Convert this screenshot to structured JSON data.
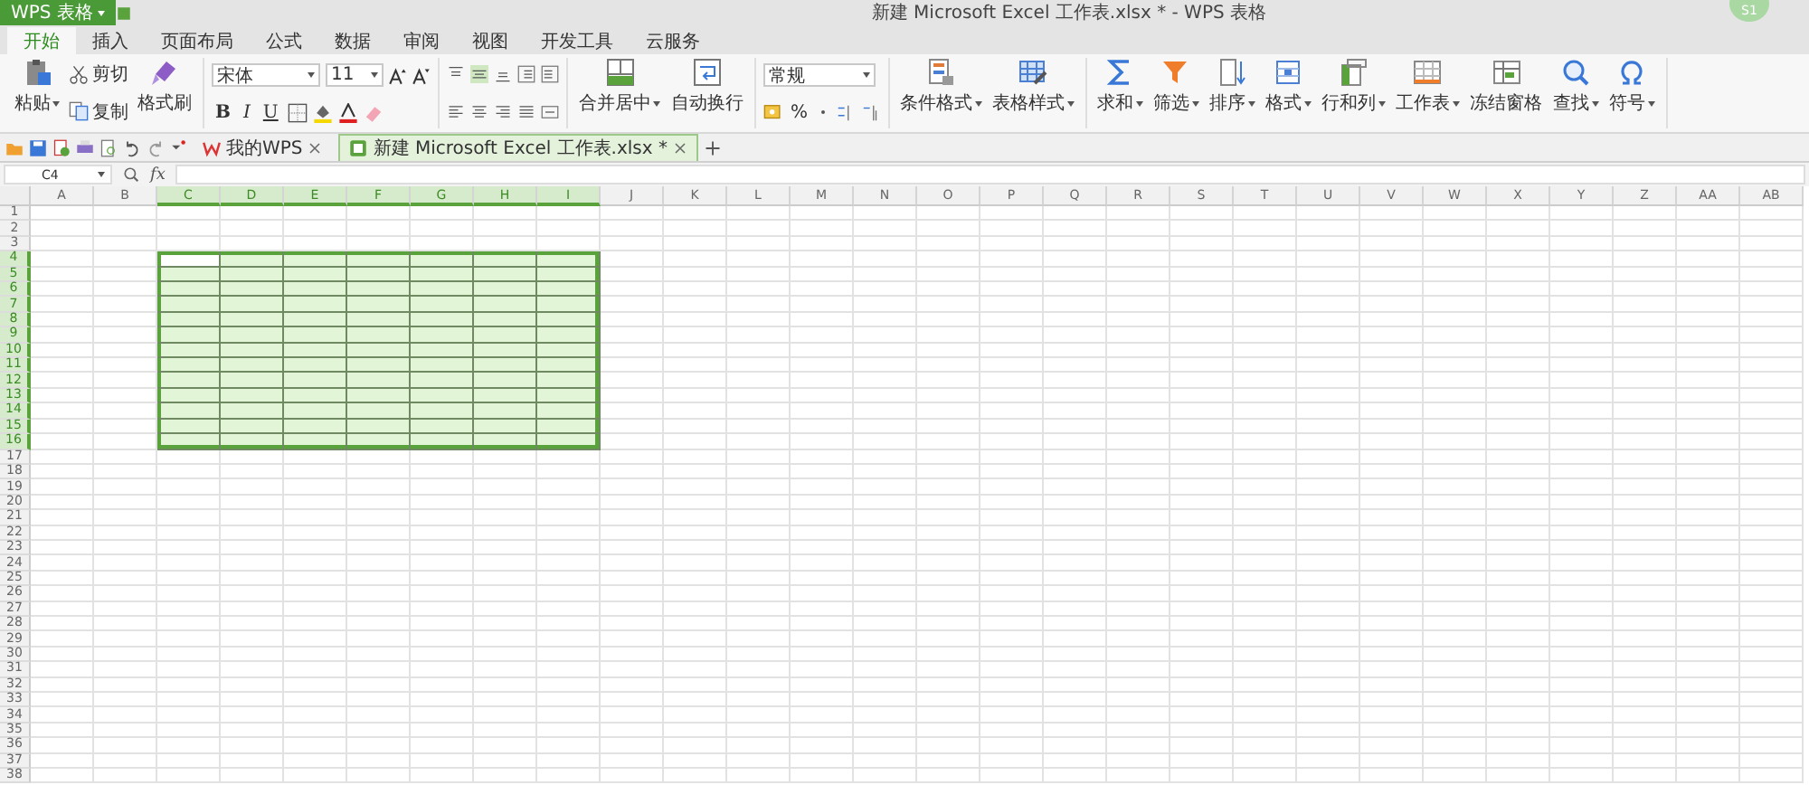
{
  "title_bar": {
    "app_button": "WPS 表格",
    "title": "新建 Microsoft Excel 工作表.xlsx * - WPS 表格",
    "avatar": "S1"
  },
  "menu_tabs": [
    {
      "label": "开始",
      "selected": true
    },
    {
      "label": "插入",
      "selected": false
    },
    {
      "label": "页面布局",
      "selected": false
    },
    {
      "label": "公式",
      "selected": false
    },
    {
      "label": "数据",
      "selected": false
    },
    {
      "label": "审阅",
      "selected": false
    },
    {
      "label": "视图",
      "selected": false
    },
    {
      "label": "开发工具",
      "selected": false
    },
    {
      "label": "云服务",
      "selected": false
    }
  ],
  "ribbon": {
    "paste": "粘贴",
    "cut": "剪切",
    "copy": "复制",
    "format_painter": "格式刷",
    "font_name": "宋体",
    "font_size": "11",
    "bold": "B",
    "italic": "I",
    "underline": "U",
    "merge_center": "合并居中",
    "wrap_text": "自动换行",
    "number_format": "常规",
    "percent": "%",
    "style_tools": [
      {
        "label": "条件格式",
        "kind": "cond",
        "dropdown": true
      },
      {
        "label": "表格样式",
        "kind": "tablestyle",
        "dropdown": true
      }
    ],
    "tools": [
      {
        "label": "求和",
        "kind": "sum",
        "dropdown": true
      },
      {
        "label": "筛选",
        "kind": "filter",
        "dropdown": true
      },
      {
        "label": "排序",
        "kind": "sort",
        "dropdown": true
      },
      {
        "label": "格式",
        "kind": "format",
        "dropdown": true
      },
      {
        "label": "行和列",
        "kind": "rowcol",
        "dropdown": true
      },
      {
        "label": "工作表",
        "kind": "sheet",
        "dropdown": true
      },
      {
        "label": "冻结窗格",
        "kind": "freeze",
        "dropdown": false
      },
      {
        "label": "查找",
        "kind": "find",
        "dropdown": true
      },
      {
        "label": "符号",
        "kind": "symbol",
        "dropdown": true
      }
    ]
  },
  "doc_tabs": [
    {
      "label": "我的WPS",
      "kind": "home",
      "selected": false
    },
    {
      "label": "新建 Microsoft Excel 工作表.xlsx *",
      "kind": "sheet",
      "selected": true
    }
  ],
  "formula_bar": {
    "name_box": "C4",
    "function_label": "fx"
  },
  "grid": {
    "columns": [
      {
        "label": "A",
        "selected": false,
        "active": false
      },
      {
        "label": "B",
        "selected": false,
        "active": false
      },
      {
        "label": "C",
        "selected": true,
        "active": true
      },
      {
        "label": "D",
        "selected": true,
        "active": false
      },
      {
        "label": "E",
        "selected": true,
        "active": false
      },
      {
        "label": "F",
        "selected": true,
        "active": false
      },
      {
        "label": "G",
        "selected": true,
        "active": false
      },
      {
        "label": "H",
        "selected": true,
        "active": false
      },
      {
        "label": "I",
        "selected": true,
        "active": false
      },
      {
        "label": "J",
        "selected": false,
        "active": false
      },
      {
        "label": "K",
        "selected": false,
        "active": false
      },
      {
        "label": "L",
        "selected": false,
        "active": false
      },
      {
        "label": "M",
        "selected": false,
        "active": false
      },
      {
        "label": "N",
        "selected": false,
        "active": false
      },
      {
        "label": "O",
        "selected": false,
        "active": false
      },
      {
        "label": "P",
        "selected": false,
        "active": false
      },
      {
        "label": "Q",
        "selected": false,
        "active": false
      },
      {
        "label": "R",
        "selected": false,
        "active": false
      },
      {
        "label": "S",
        "selected": false,
        "active": false
      },
      {
        "label": "T",
        "selected": false,
        "active": false
      },
      {
        "label": "U",
        "selected": false,
        "active": false
      },
      {
        "label": "V",
        "selected": false,
        "active": false
      },
      {
        "label": "W",
        "selected": false,
        "active": false
      },
      {
        "label": "X",
        "selected": false,
        "active": false
      },
      {
        "label": "Y",
        "selected": false,
        "active": false
      },
      {
        "label": "Z",
        "selected": false,
        "active": false
      },
      {
        "label": "AA",
        "selected": false,
        "active": false
      },
      {
        "label": "AB",
        "selected": false,
        "active": false
      }
    ],
    "rows": [
      {
        "label": "1",
        "selected": false,
        "active": false
      },
      {
        "label": "2",
        "selected": false,
        "active": false
      },
      {
        "label": "3",
        "selected": false,
        "active": false
      },
      {
        "label": "4",
        "selected": true,
        "active": true
      },
      {
        "label": "5",
        "selected": true,
        "active": false
      },
      {
        "label": "6",
        "selected": true,
        "active": false
      },
      {
        "label": "7",
        "selected": true,
        "active": false
      },
      {
        "label": "8",
        "selected": true,
        "active": false
      },
      {
        "label": "9",
        "selected": true,
        "active": false
      },
      {
        "label": "10",
        "selected": true,
        "active": false
      },
      {
        "label": "11",
        "selected": true,
        "active": false
      },
      {
        "label": "12",
        "selected": true,
        "active": false
      },
      {
        "label": "13",
        "selected": true,
        "active": false
      },
      {
        "label": "14",
        "selected": true,
        "active": false
      },
      {
        "label": "15",
        "selected": true,
        "active": false
      },
      {
        "label": "16",
        "selected": true,
        "active": false
      },
      {
        "label": "17",
        "selected": false,
        "active": false
      },
      {
        "label": "18",
        "selected": false,
        "active": false
      },
      {
        "label": "19",
        "selected": false,
        "active": false
      },
      {
        "label": "20",
        "selected": false,
        "active": false
      },
      {
        "label": "21",
        "selected": false,
        "active": false
      },
      {
        "label": "22",
        "selected": false,
        "active": false
      },
      {
        "label": "23",
        "selected": false,
        "active": false
      },
      {
        "label": "24",
        "selected": false,
        "active": false
      },
      {
        "label": "25",
        "selected": false,
        "active": false
      },
      {
        "label": "26",
        "selected": false,
        "active": false
      },
      {
        "label": "27",
        "selected": false,
        "active": false
      },
      {
        "label": "28",
        "selected": false,
        "active": false
      },
      {
        "label": "29",
        "selected": false,
        "active": false
      },
      {
        "label": "30",
        "selected": false,
        "active": false
      },
      {
        "label": "31",
        "selected": false,
        "active": false
      },
      {
        "label": "32",
        "selected": false,
        "active": false
      },
      {
        "label": "33",
        "selected": false,
        "active": false
      },
      {
        "label": "34",
        "selected": false,
        "active": false
      },
      {
        "label": "35",
        "selected": false,
        "active": false
      },
      {
        "label": "36",
        "selected": false,
        "active": false
      },
      {
        "label": "37",
        "selected": false,
        "active": false
      },
      {
        "label": "38",
        "selected": false,
        "active": false
      }
    ]
  }
}
